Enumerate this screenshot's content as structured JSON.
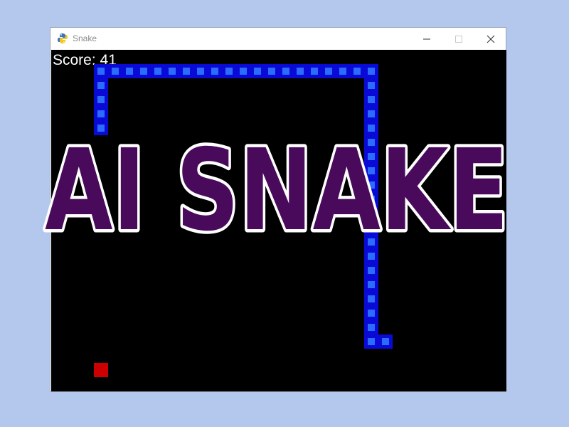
{
  "window": {
    "title": "Snake",
    "icon": "python-snake-icon",
    "controls": [
      "minimize-icon",
      "maximize-icon",
      "close-icon"
    ]
  },
  "game": {
    "score_text": "Score: 41",
    "snake_cells": [
      [
        3,
        1
      ],
      [
        4,
        1
      ],
      [
        5,
        1
      ],
      [
        6,
        1
      ],
      [
        7,
        1
      ],
      [
        8,
        1
      ],
      [
        9,
        1
      ],
      [
        10,
        1
      ],
      [
        11,
        1
      ],
      [
        12,
        1
      ],
      [
        13,
        1
      ],
      [
        14,
        1
      ],
      [
        15,
        1
      ],
      [
        16,
        1
      ],
      [
        17,
        1
      ],
      [
        18,
        1
      ],
      [
        19,
        1
      ],
      [
        20,
        1
      ],
      [
        21,
        1
      ],
      [
        22,
        1
      ],
      [
        3,
        2
      ],
      [
        3,
        3
      ],
      [
        3,
        4
      ],
      [
        3,
        5
      ],
      [
        22,
        2
      ],
      [
        22,
        3
      ],
      [
        22,
        4
      ],
      [
        22,
        5
      ],
      [
        22,
        6
      ],
      [
        22,
        7
      ],
      [
        22,
        8
      ],
      [
        22,
        9
      ],
      [
        22,
        10
      ],
      [
        22,
        11
      ],
      [
        22,
        12
      ],
      [
        22,
        13
      ],
      [
        22,
        14
      ],
      [
        22,
        15
      ],
      [
        22,
        16
      ],
      [
        22,
        17
      ],
      [
        22,
        18
      ],
      [
        22,
        19
      ],
      [
        22,
        20
      ],
      [
        23,
        20
      ]
    ],
    "food_cell": [
      3,
      22
    ]
  },
  "overlay": {
    "title": "AI SNAKE"
  },
  "colors": {
    "background": "#b4c8ee",
    "game_bg": "#000000",
    "snake_fill": "#2b6cff",
    "snake_border": "#0a0ad6",
    "food": "#cc0000",
    "title_fill": "#4a0a5c",
    "title_stroke": "#ffffff"
  }
}
